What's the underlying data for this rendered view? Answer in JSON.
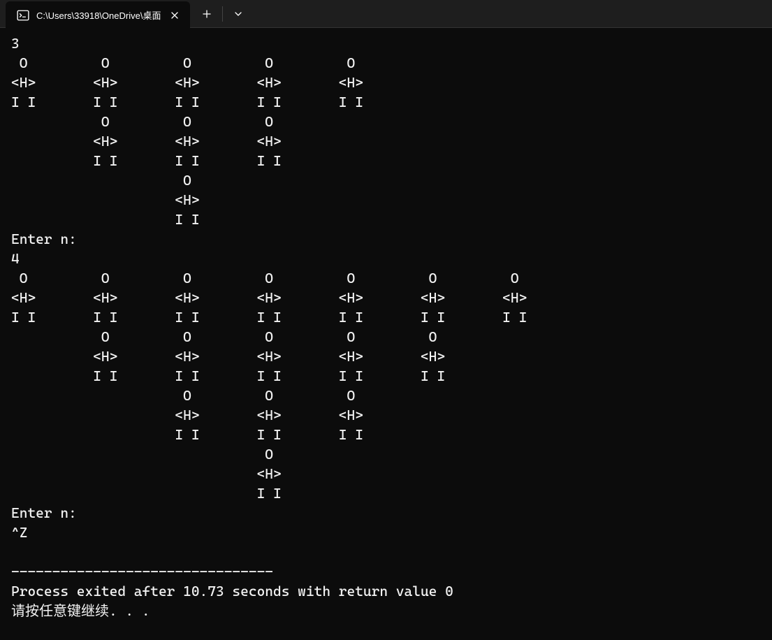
{
  "titlebar": {
    "tab_title": "C:\\Users\\33918\\OneDrive\\桌面"
  },
  "terminal": {
    "lines": [
      "3",
      " O         O         O         O         O",
      "<H>       <H>       <H>       <H>       <H>",
      "I I       I I       I I       I I       I I",
      "           O         O         O",
      "          <H>       <H>       <H>",
      "          I I       I I       I I",
      "                     O",
      "                    <H>",
      "                    I I",
      "Enter n:",
      "4",
      " O         O         O         O         O         O         O",
      "<H>       <H>       <H>       <H>       <H>       <H>       <H>",
      "I I       I I       I I       I I       I I       I I       I I",
      "           O         O         O         O         O",
      "          <H>       <H>       <H>       <H>       <H>",
      "          I I       I I       I I       I I       I I",
      "                     O         O         O",
      "                    <H>       <H>       <H>",
      "                    I I       I I       I I",
      "                               O",
      "                              <H>",
      "                              I I",
      "Enter n:",
      "^Z",
      "",
      "--------------------------------",
      "Process exited after 10.73 seconds with return value 0",
      "请按任意键继续. . ."
    ]
  }
}
